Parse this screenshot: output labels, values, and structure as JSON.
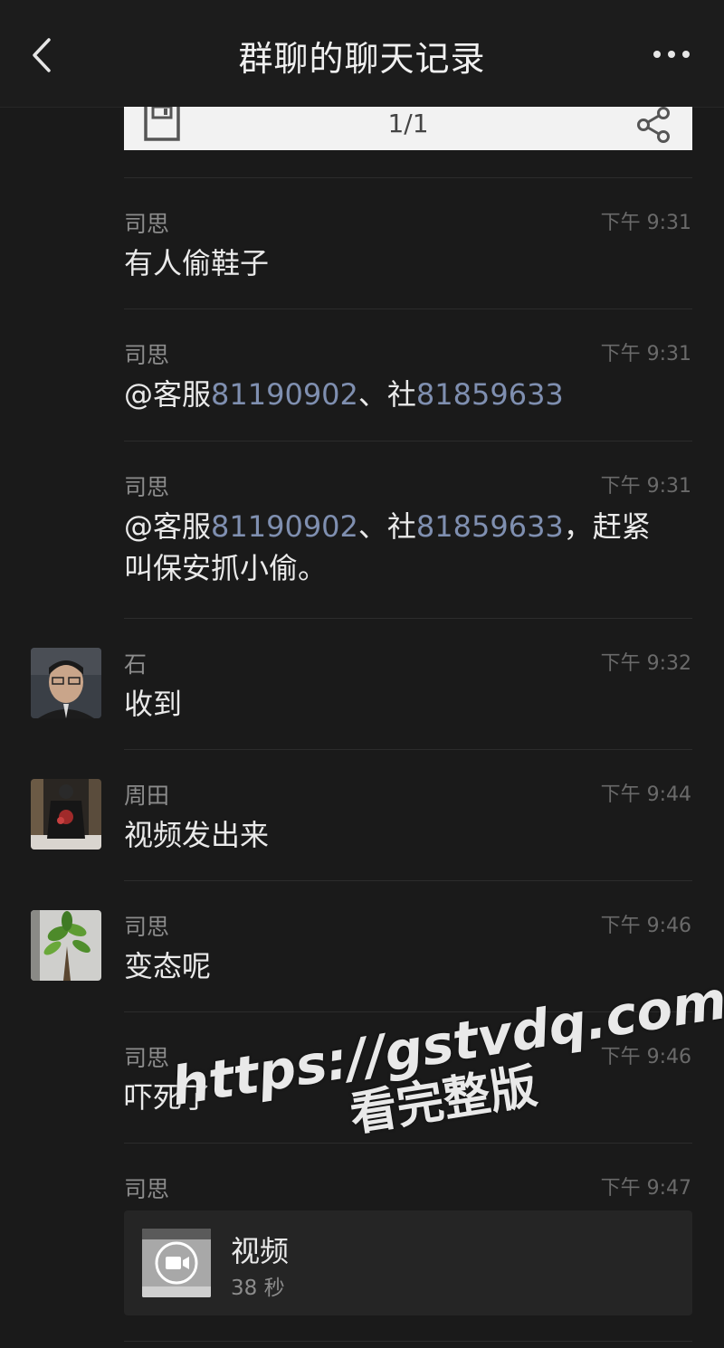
{
  "header": {
    "title": "群聊的聊天记录",
    "back_icon": "chevron-left-icon",
    "more_icon": "more-horizontal-icon"
  },
  "card": {
    "page_indicator": "1/1",
    "save_icon": "save-icon",
    "share_icon": "share-icon"
  },
  "messages": [
    {
      "sender": "司思",
      "time": "下午 9:31",
      "text": "有人偷鞋子"
    },
    {
      "sender": "司思",
      "time": "下午 9:31",
      "parts": [
        "@客服",
        "81190902",
        "、社",
        "81859633"
      ]
    },
    {
      "sender": "司思",
      "time": "下午 9:31",
      "parts": [
        "@客服",
        "81190902",
        "、社",
        "81859633",
        "，赶紧",
        "叫保安抓小偷。"
      ]
    },
    {
      "sender": "石",
      "time": "下午 9:32",
      "text": "收到"
    },
    {
      "sender": "周田",
      "time": "下午 9:44",
      "text": "视频发出来"
    },
    {
      "sender": "司思",
      "time": "下午 9:46",
      "text": "变态呢"
    },
    {
      "sender": "司思",
      "time": "下午 9:46",
      "text": "吓死了"
    },
    {
      "sender": "司思",
      "time": "下午 9:47",
      "video": {
        "title": "视频",
        "duration": "38 秒"
      }
    }
  ],
  "watermark": {
    "url": "https://gstvdq.com",
    "subtitle": "看完整版"
  },
  "colors": {
    "background": "#1a1a1a",
    "mention": "#7f8fb0",
    "muted": "#8c8c8c"
  }
}
